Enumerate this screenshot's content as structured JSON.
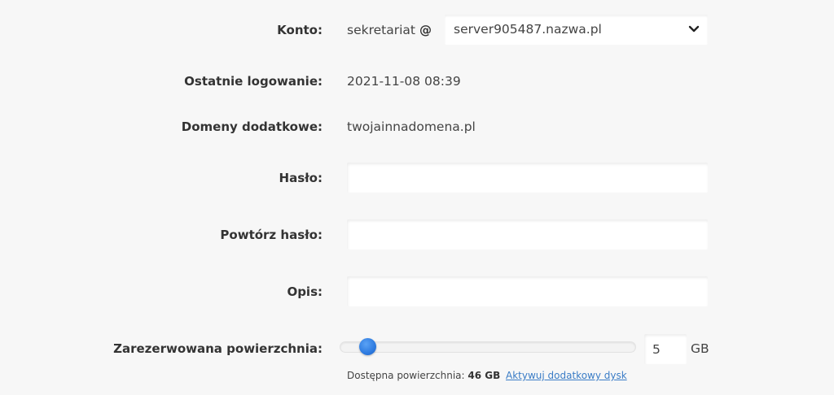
{
  "account": {
    "label": "Konto:",
    "username": "sekretariat",
    "at": "@",
    "domain_selected": "server905487.nazwa.pl"
  },
  "last_login": {
    "label": "Ostatnie logowanie:",
    "value": "2021-11-08 08:39"
  },
  "extra_domains": {
    "label": "Domeny dodatkowe:",
    "value": "twojainnadomena.pl"
  },
  "password": {
    "label": "Hasło:",
    "value": ""
  },
  "password_repeat": {
    "label": "Powtórz hasło:",
    "value": ""
  },
  "description": {
    "label": "Opis:",
    "value": ""
  },
  "reserved_space": {
    "label": "Zarezerwowana powierzchnia:",
    "value": "5",
    "unit": "GB",
    "slider_fraction": 0.1,
    "available_label": "Dostępna powierzchnia:",
    "available_value": "46 GB",
    "activate_link": "Aktywuj dodatkowy dysk"
  },
  "colors": {
    "background": "#f7f7f7",
    "accent": "#2e7be0",
    "link": "#3a7cc6"
  },
  "icons": {
    "select_arrow": "chevron-down-icon"
  }
}
